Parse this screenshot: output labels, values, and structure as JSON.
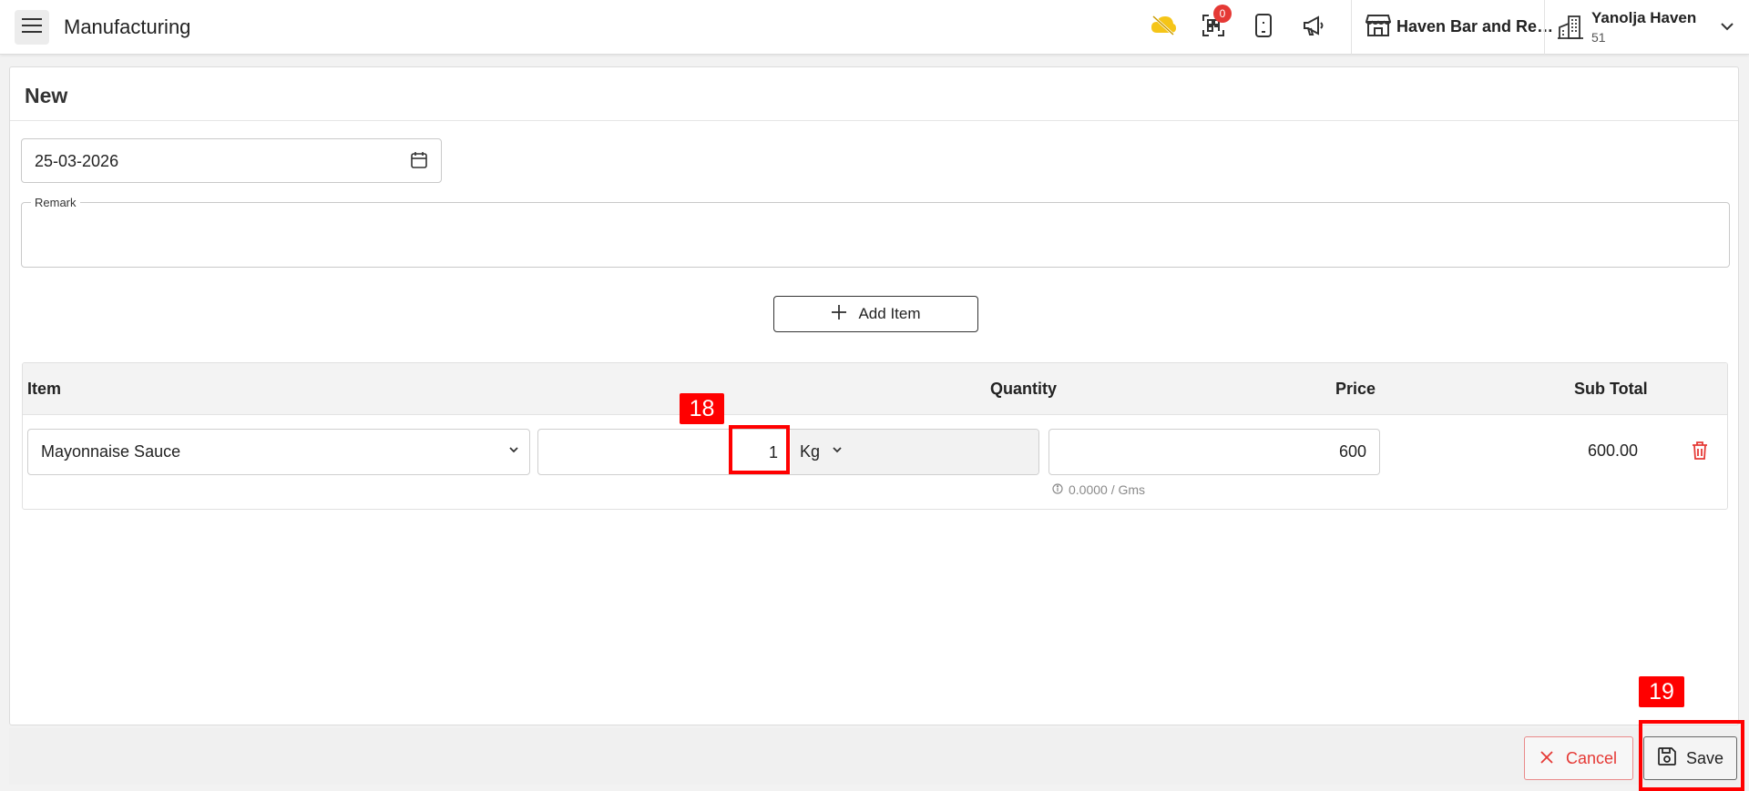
{
  "header": {
    "title": "Manufacturing",
    "qr_badge": "0",
    "outlet_name": "Haven Bar and Restaurant",
    "user_name": "Yanolja Haven",
    "user_code": "51"
  },
  "form": {
    "title": "New",
    "date_value": "25-03-2026",
    "remark_label": "Remark",
    "remark_value": "",
    "add_item_label": "Add Item"
  },
  "table": {
    "headers": {
      "item": "Item",
      "quantity": "Quantity",
      "price": "Price",
      "subtotal": "Sub Total"
    },
    "row": {
      "item": "Mayonnaise Sauce",
      "quantity": "1",
      "unit": "Kg",
      "price": "600",
      "price_hint": "0.0000 / Gms",
      "subtotal": "600.00"
    }
  },
  "footer": {
    "cancel_label": "Cancel",
    "save_label": "Save"
  },
  "annotations": {
    "qty_tag": "18",
    "save_tag": "19"
  },
  "colors": {
    "accent_red": "#e53935",
    "annotation_red": "#ff0000",
    "cloud_yellow": "#f5c518"
  },
  "icons": {
    "menu": "hamburger-icon",
    "cloud": "cloud-off-icon",
    "qr": "qr-scan-icon",
    "phone": "mobile-icon",
    "announce": "megaphone-icon",
    "store": "store-icon",
    "building": "building-icon",
    "calendar": "calendar-icon",
    "plus": "plus-icon",
    "trash": "trash-icon",
    "cancel": "close-icon",
    "save": "floppy-disk-icon"
  }
}
